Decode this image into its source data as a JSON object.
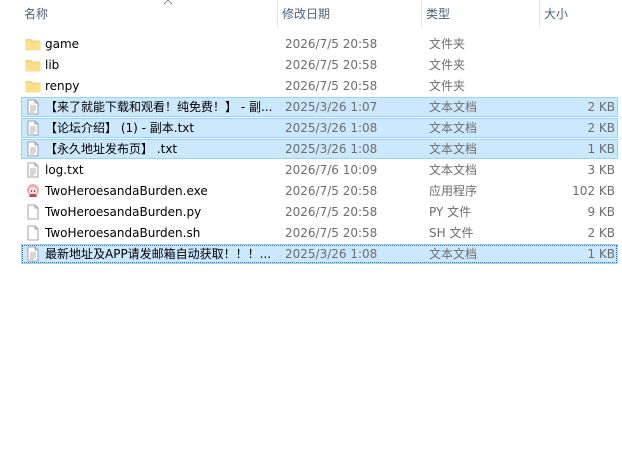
{
  "columns": {
    "name": "名称",
    "date": "修改日期",
    "type": "类型",
    "size": "大小"
  },
  "files": [
    {
      "name": "game",
      "date": "2026/7/5 20:58",
      "type": "文件夹",
      "size": "",
      "icon": "folder-icon",
      "state": "normal"
    },
    {
      "name": "lib",
      "date": "2026/7/5 20:58",
      "type": "文件夹",
      "size": "",
      "icon": "folder-icon",
      "state": "normal"
    },
    {
      "name": "renpy",
      "date": "2026/7/5 20:58",
      "type": "文件夹",
      "size": "",
      "icon": "folder-icon",
      "state": "normal"
    },
    {
      "name": "【来了就能下载和观看！纯免费！】 - 副...",
      "date": "2025/3/26 1:07",
      "type": "文本文档",
      "size": "2 KB",
      "icon": "text-file-icon",
      "state": "selected"
    },
    {
      "name": "【论坛介绍】 (1) - 副本.txt",
      "date": "2025/3/26 1:08",
      "type": "文本文档",
      "size": "2 KB",
      "icon": "text-file-icon",
      "state": "selected"
    },
    {
      "name": "【永久地址发布页】 .txt",
      "date": "2025/3/26 1:08",
      "type": "文本文档",
      "size": "1 KB",
      "icon": "text-file-icon",
      "state": "selected"
    },
    {
      "name": "log.txt",
      "date": "2026/7/6 10:09",
      "type": "文本文档",
      "size": "3 KB",
      "icon": "text-file-icon",
      "state": "normal"
    },
    {
      "name": "TwoHeroesandaBurden.exe",
      "date": "2026/7/5 20:58",
      "type": "应用程序",
      "size": "102 KB",
      "icon": "app-exe-icon",
      "state": "normal"
    },
    {
      "name": "TwoHeroesandaBurden.py",
      "date": "2026/7/5 20:58",
      "type": "PY 文件",
      "size": "9 KB",
      "icon": "blank-file-icon",
      "state": "normal"
    },
    {
      "name": "TwoHeroesandaBurden.sh",
      "date": "2026/7/5 20:58",
      "type": "SH 文件",
      "size": "2 KB",
      "icon": "blank-file-icon",
      "state": "normal"
    },
    {
      "name": "最新地址及APP请发邮箱自动获取！！！...",
      "date": "2025/3/26 1:08",
      "type": "文本文档",
      "size": "1 KB",
      "icon": "text-file-icon",
      "state": "focus"
    }
  ],
  "colors": {
    "selection_bg": "#cce8ff",
    "selection_border": "#99d1ff",
    "folder": "#f8d775"
  }
}
